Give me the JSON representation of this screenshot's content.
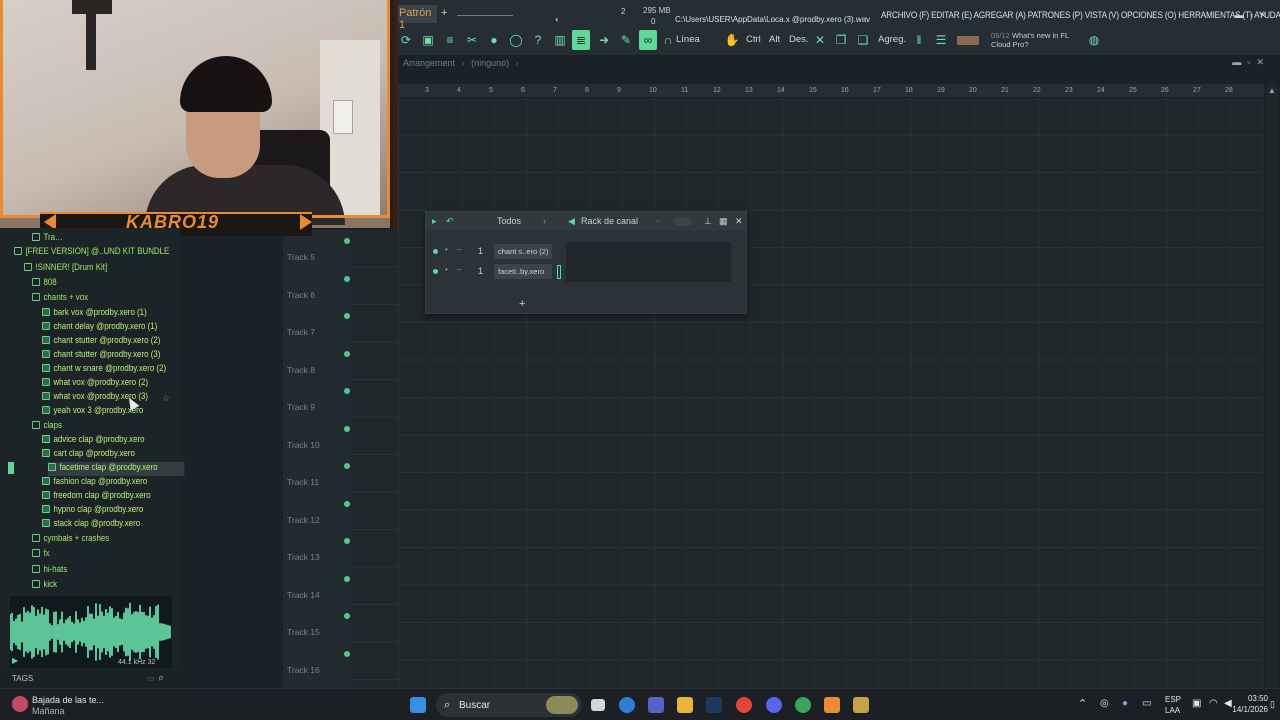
{
  "window": {
    "pattern_label": "Patrón 1",
    "memory": "295 MB",
    "cpu_counter": "2",
    "cpu_zero": "0",
    "file_path": "C:\\Users\\USER\\AppData\\Loca.x @prodby.xero (3).wav",
    "menu_text": "ARCHIVO (F) EDITAR (E) AGREGAR (A) PATRONES (P) VISTA (V) OPCIONES (O) HERRAMIENTAS (T) AYUDA"
  },
  "toolbar": {
    "line_mode": "Línea",
    "ctrl": "Ctrl",
    "alt": "Alt",
    "des": "Des.",
    "agreg": "Agreg.",
    "news_date": "09/12",
    "news_text": "What's new in FL",
    "news_text2": "Cloud Pro?"
  },
  "arrangement": {
    "title": "Arrangement",
    "subtitle": "(ninguno)",
    "ruler_ticks": [
      "3",
      "4",
      "5",
      "6",
      "7",
      "8",
      "9",
      "10",
      "11",
      "12",
      "13",
      "14",
      "15",
      "16",
      "17",
      "18",
      "19",
      "20",
      "21",
      "22",
      "23",
      "24",
      "25",
      "26",
      "27",
      "28"
    ]
  },
  "tracks": [
    "Track 5",
    "Track 6",
    "Track 7",
    "Track 8",
    "Track 9",
    "Track 10",
    "Track 11",
    "Track 12",
    "Track 13",
    "Track 14",
    "Track 15",
    "Track 16"
  ],
  "browser": {
    "items": [
      {
        "label": "Tra…",
        "kind": "folder"
      },
      {
        "label": "[FREE VERSION] @..UND KIT BUNDLE",
        "kind": "folder"
      },
      {
        "label": "!SINNER! [Drum Kit]",
        "kind": "folder"
      },
      {
        "label": "808",
        "kind": "folder"
      },
      {
        "label": "chants + vox",
        "kind": "folder"
      },
      {
        "label": "bark vox @prodby.xero (1)",
        "kind": "file"
      },
      {
        "label": "chant delay @prodby.xero (1)",
        "kind": "file"
      },
      {
        "label": "chant stutter @prodby.xero (2)",
        "kind": "file"
      },
      {
        "label": "chant stutter @prodby.xero (3)",
        "kind": "file"
      },
      {
        "label": "chant w snare @prodby.xero (2)",
        "kind": "file"
      },
      {
        "label": "what vox @prodby.xero (2)",
        "kind": "file"
      },
      {
        "label": "what vox @prodby.xero (3)",
        "kind": "file"
      },
      {
        "label": "yeah vox 3 @prodby.xero",
        "kind": "file"
      },
      {
        "label": "claps",
        "kind": "folder"
      },
      {
        "label": "advice clap @prodby.xero",
        "kind": "file"
      },
      {
        "label": "cart clap @prodby.xero",
        "kind": "file"
      },
      {
        "label": "facetime clap @prodby.xero",
        "kind": "file"
      },
      {
        "label": "fashion clap @prodby.xero",
        "kind": "file"
      },
      {
        "label": "freedom clap @prodby.xero",
        "kind": "file"
      },
      {
        "label": "hypno clap @prodby.xero",
        "kind": "file"
      },
      {
        "label": "stack clap @prodby.xero",
        "kind": "file"
      },
      {
        "label": "cymbals + crashes",
        "kind": "folder"
      },
      {
        "label": "fx",
        "kind": "folder"
      },
      {
        "label": "hi-hats",
        "kind": "folder"
      },
      {
        "label": "kick",
        "kind": "folder"
      }
    ],
    "wave_info": "44.1 kHz 32",
    "tags_label": "TAGS"
  },
  "webcam": {
    "banner_text": "KABRO19"
  },
  "channel_rack": {
    "filter": "Todos",
    "title": "Rack de canal",
    "channels": [
      {
        "number": "1",
        "name": "chant s..ero (2)"
      },
      {
        "number": "1",
        "name": "faceti..by.xero"
      }
    ]
  },
  "taskbar": {
    "weather_title": "Bajada de las te...",
    "weather_sub": "Mañana",
    "search_placeholder": "Buscar",
    "lang1": "ESP",
    "lang2": "LAA",
    "time": "03:50",
    "date": "14/1/2026"
  },
  "colors": {
    "accent": "#5fd69a",
    "browser_text": "#b8f07b",
    "stream_orange": "#e98a34"
  }
}
